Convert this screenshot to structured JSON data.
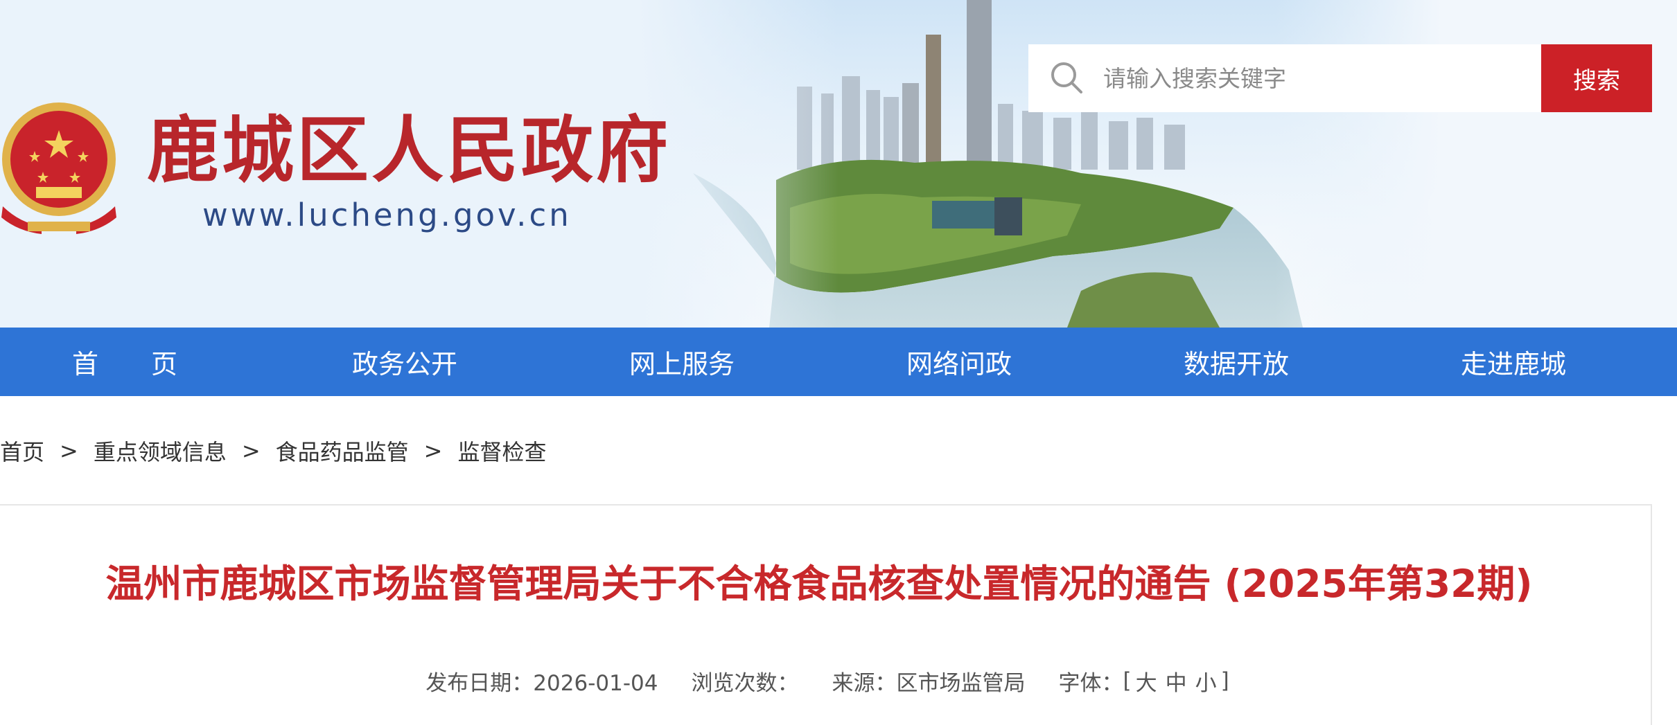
{
  "header": {
    "site_title": "鹿城区人民政府",
    "site_url": "www.lucheng.gov.cn"
  },
  "search": {
    "placeholder": "请输入搜索关键字",
    "button_label": "搜索"
  },
  "nav": {
    "items": [
      {
        "label": "首　　页"
      },
      {
        "label": "政务公开"
      },
      {
        "label": "网上服务"
      },
      {
        "label": "网络问政"
      },
      {
        "label": "数据开放"
      },
      {
        "label": "走进鹿城"
      }
    ]
  },
  "breadcrumb": {
    "items": [
      "首页",
      "重点领域信息",
      "食品药品监管",
      "监督检查"
    ],
    "separator": ">"
  },
  "article": {
    "title": "温州市鹿城区市场监督管理局关于不合格食品核查处置情况的通告 (2025年第32期)",
    "meta": {
      "date_label": "发布日期：",
      "date_value": "2026-01-04",
      "views_label": "浏览次数：",
      "views_value": "",
      "source_label": "来源：",
      "source_value": "区市场监管局",
      "font_label": "字体：",
      "bracket_open": "[",
      "font_large": "大",
      "font_medium": "中",
      "font_small": "小",
      "bracket_close": "]"
    }
  },
  "colors": {
    "nav_bg": "#2e74d6",
    "accent_red": "#cc2127",
    "title_red": "#c8282b",
    "url_blue": "#2c4a86"
  },
  "icons": {
    "emblem": "national-emblem-icon",
    "search": "search-icon"
  }
}
